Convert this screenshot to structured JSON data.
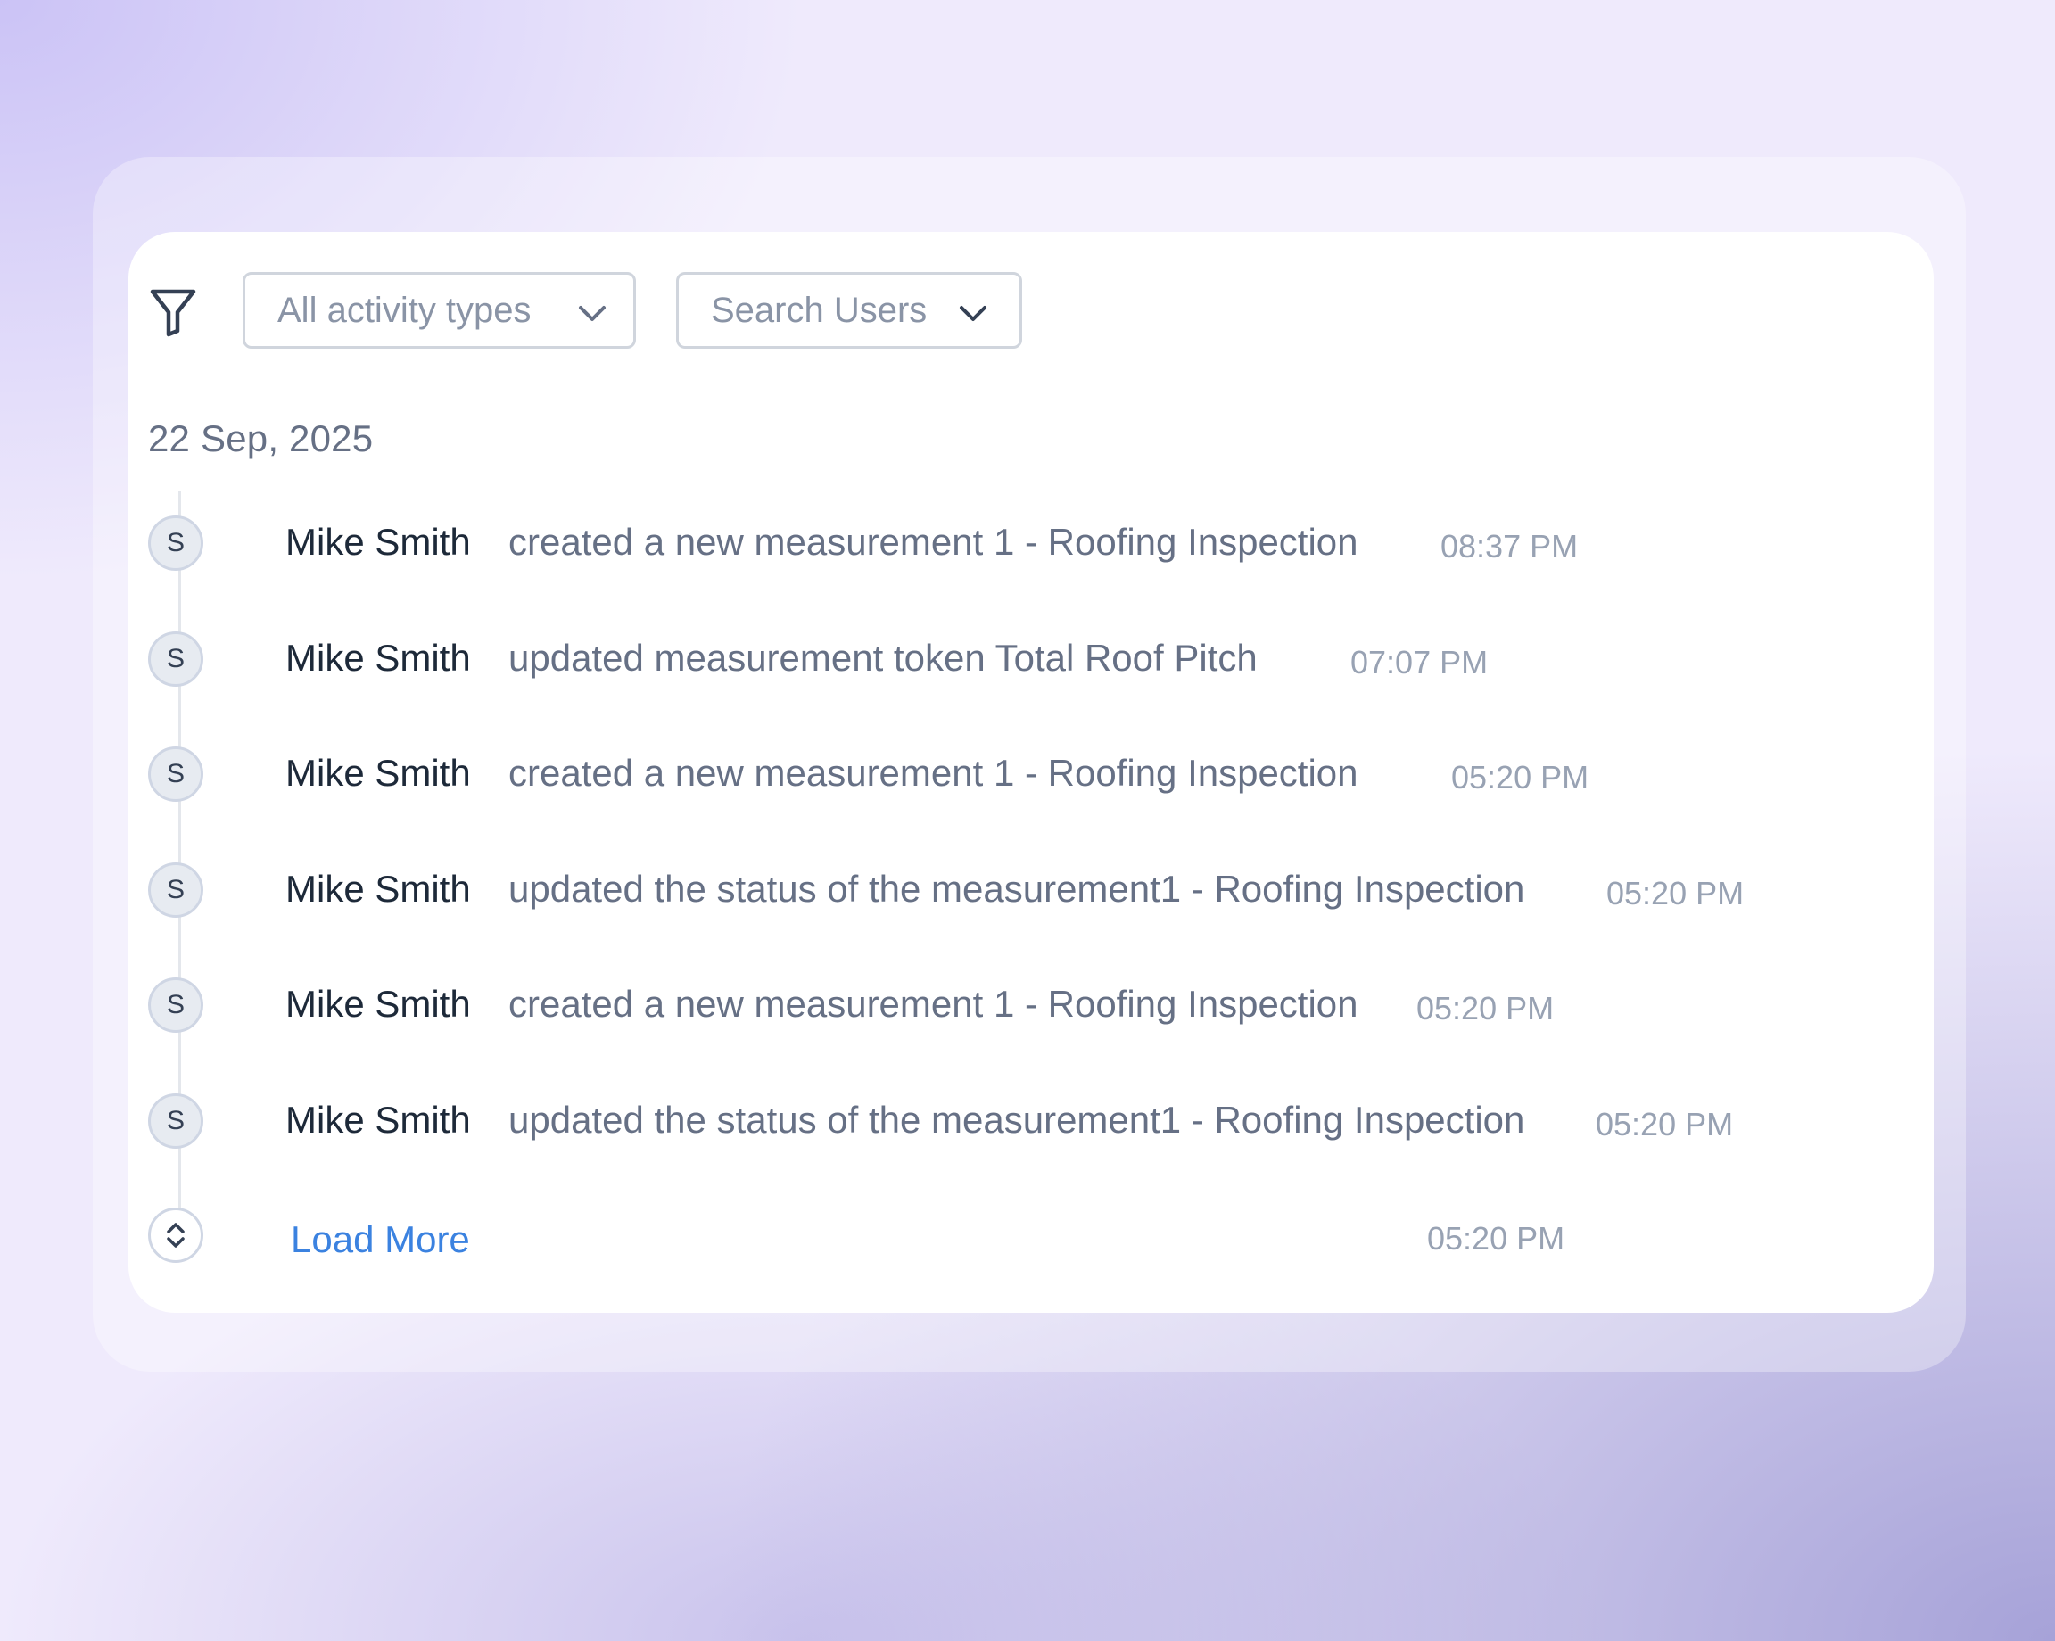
{
  "filters": {
    "activity_type": "All activity types",
    "users": "Search Users"
  },
  "date_group": "22 Sep, 2025",
  "activities": [
    {
      "avatar": "S",
      "user": "Mike Smith",
      "action": "created a new measurement 1 - Roofing Inspection",
      "time": "08:37 PM"
    },
    {
      "avatar": "S",
      "user": "Mike Smith",
      "action": "updated measurement token Total Roof Pitch",
      "time": "07:07 PM"
    },
    {
      "avatar": "S",
      "user": "Mike Smith",
      "action": "created a new measurement 1 - Roofing Inspection",
      "time": "05:20 PM"
    },
    {
      "avatar": "S",
      "user": "Mike Smith",
      "action": "updated the status of the measurement1 - Roofing Inspection",
      "time": "05:20 PM"
    },
    {
      "avatar": "S",
      "user": "Mike Smith",
      "action": "created a new measurement 1 - Roofing Inspection",
      "time": "05:20 PM"
    },
    {
      "avatar": "S",
      "user": "Mike Smith",
      "action": "updated the status of the measurement1 - Roofing Inspection",
      "time": "05:20 PM"
    }
  ],
  "load_more": {
    "label": "Load More",
    "time": "05:20 PM"
  },
  "icons": {
    "filter": "filter-funnel-icon",
    "dropdown": "chevron-down-icon",
    "load_more": "expand-vertical-icon"
  },
  "colors": {
    "link": "#3b82e0",
    "user_name": "#1d2939",
    "action_text": "#667085",
    "timestamp": "#98a2b3"
  }
}
